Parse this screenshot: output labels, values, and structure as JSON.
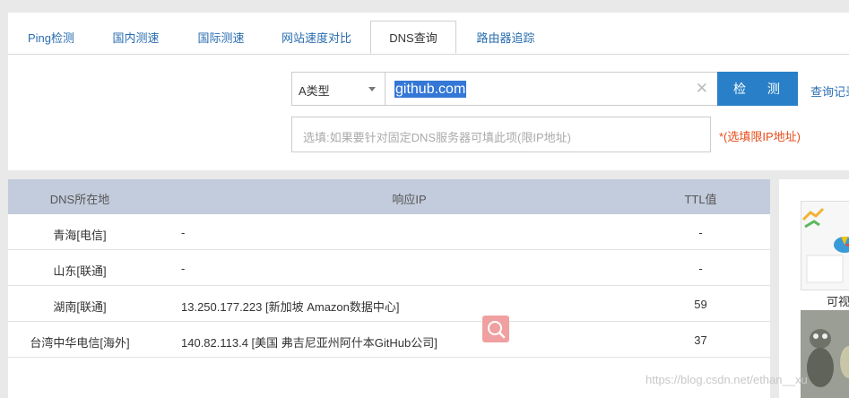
{
  "tabs": [
    {
      "label": "Ping检测"
    },
    {
      "label": "国内测速"
    },
    {
      "label": "国际测速"
    },
    {
      "label": "网站速度对比"
    },
    {
      "label": "DNS查询"
    },
    {
      "label": "路由器追踪"
    }
  ],
  "active_tab": "DNS查询",
  "query": {
    "record_type": "A类型",
    "domain_value": "github.com",
    "check_label": "检 测",
    "history_link": "查询记录",
    "dns_placeholder": "选填:如果要针对固定DNS服务器可填此项(限IP地址)",
    "dns_note": "*(选填限IP地址)"
  },
  "table": {
    "headers": [
      "DNS所在地",
      "响应IP",
      "TTL值"
    ],
    "rows": [
      {
        "location": "青海[电信]",
        "ip": "-",
        "ttl": "-"
      },
      {
        "location": "山东[联通]",
        "ip": "-",
        "ttl": "-"
      },
      {
        "location": "湖南[联通]",
        "ip": "13.250.177.223 [新加坡 Amazon数据中心]",
        "ttl": "59"
      },
      {
        "location": "台湾中华电信[海外]",
        "ip": "140.82.113.4 [美国 弗吉尼亚州阿什本GitHub公司]",
        "ttl": "37"
      }
    ]
  },
  "sidebar": {
    "caption": "可视"
  },
  "watermark": "https://blog.csdn.net/ethan__xu",
  "icons": {
    "float_search": "search-icon",
    "clear": "close-icon",
    "dropdown": "chevron-down-icon"
  },
  "colors": {
    "accent": "#2a80c8",
    "tab_link": "#2a6db0",
    "note": "#e84c1a",
    "table_header": "#c3ccdc"
  }
}
